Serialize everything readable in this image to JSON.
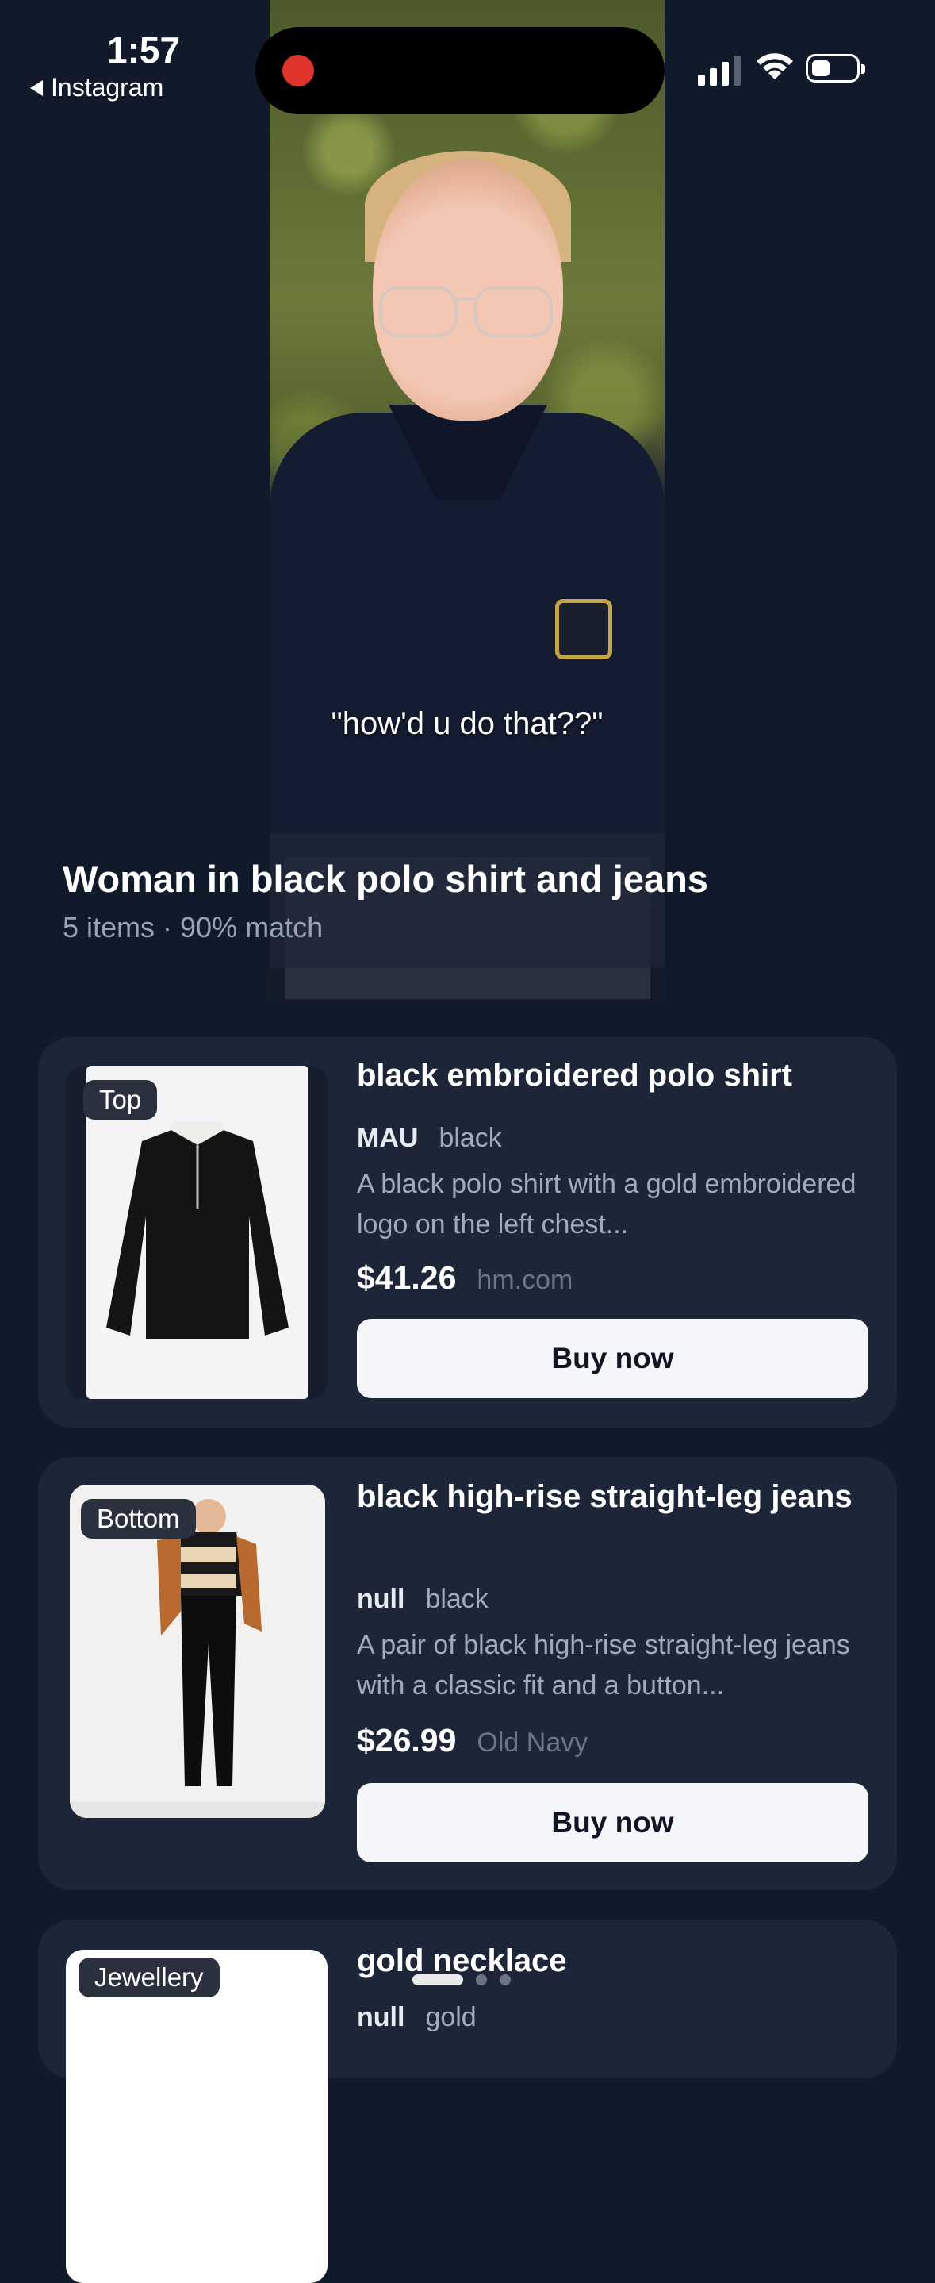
{
  "status_bar": {
    "time": "1:57",
    "back_app": "Instagram"
  },
  "video": {
    "caption": "\"how'd u do that??\""
  },
  "outfit": {
    "title": "Woman in black polo shirt and jeans",
    "subtitle": "5 items · 90% match"
  },
  "items": [
    {
      "tag": "Top",
      "name": "black embroidered polo shirt",
      "brand": "MAU",
      "color": "black",
      "description": "A black polo shirt with a gold embroidered logo on the left chest...",
      "price": "$41.26",
      "store": "hm.com",
      "button": "Buy now"
    },
    {
      "tag": "Bottom",
      "name": "black high-rise straight-leg jeans",
      "brand": "null",
      "color": "black",
      "description": "A pair of black high-rise straight-leg jeans with a classic fit and a button...",
      "price": "$26.99",
      "store": "Old Navy",
      "button": "Buy now"
    },
    {
      "tag": "Jewellery",
      "name": "gold necklace",
      "brand": "null",
      "color": "gold"
    }
  ]
}
